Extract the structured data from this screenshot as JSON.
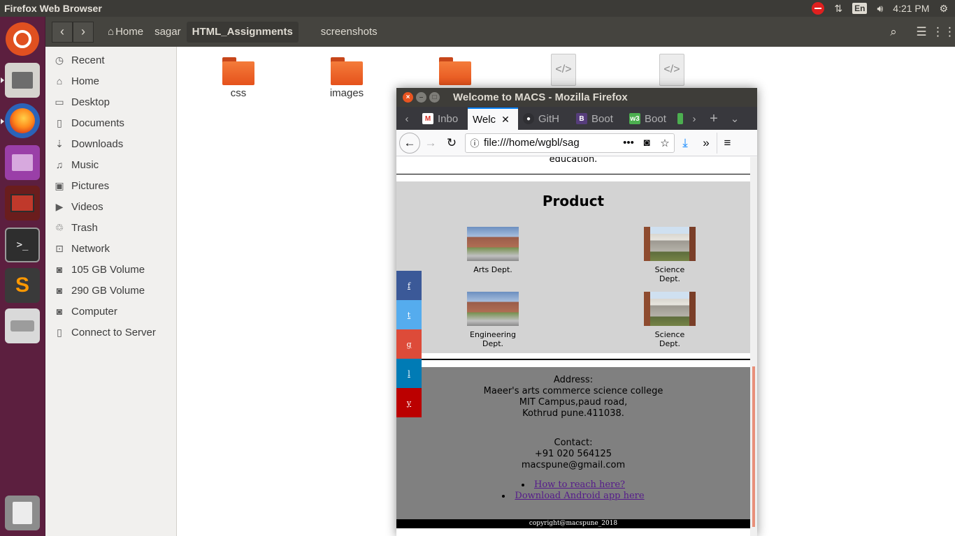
{
  "top_panel": {
    "app_title": "Firefox Web Browser",
    "lang": "En",
    "time": "4:21 PM"
  },
  "files": {
    "breadcrumbs": [
      "Home",
      "sagar",
      "HTML_Assignments",
      "screenshots"
    ],
    "sidebar": [
      {
        "label": "Recent",
        "icon": "clock-icon"
      },
      {
        "label": "Home",
        "icon": "home-icon"
      },
      {
        "label": "Desktop",
        "icon": "folder-icon"
      },
      {
        "label": "Documents",
        "icon": "document-icon"
      },
      {
        "label": "Downloads",
        "icon": "download-icon"
      },
      {
        "label": "Music",
        "icon": "music-icon"
      },
      {
        "label": "Pictures",
        "icon": "camera-icon"
      },
      {
        "label": "Videos",
        "icon": "video-icon"
      },
      {
        "label": "Trash",
        "icon": "trash-icon"
      },
      {
        "label": "Network",
        "icon": "network-icon"
      },
      {
        "label": "105 GB Volume",
        "icon": "disk-icon"
      },
      {
        "label": "290 GB Volume",
        "icon": "disk-icon"
      },
      {
        "label": "Computer",
        "icon": "computer-icon"
      },
      {
        "label": "Connect to Server",
        "icon": "server-icon"
      }
    ],
    "items": [
      {
        "label": "css",
        "type": "folder"
      },
      {
        "label": "images",
        "type": "folder"
      },
      {
        "label": "",
        "type": "folder"
      },
      {
        "label": "",
        "type": "html"
      },
      {
        "label": "",
        "type": "html"
      }
    ]
  },
  "firefox": {
    "window_title": "Welcome to MACS - Mozilla Firefox",
    "tabs": [
      {
        "label": "Inbo",
        "favicon": "gmail-icon"
      },
      {
        "label": "Welc",
        "favicon": "",
        "selected": true
      },
      {
        "label": "GitH",
        "favicon": "github-icon"
      },
      {
        "label": "Boot",
        "favicon": "bootstrap-icon"
      },
      {
        "label": "Boot",
        "favicon": "w3-icon"
      }
    ],
    "url": "file:///home/wgbl/sag",
    "page": {
      "top_text": "education.",
      "product_title": "Product",
      "products": [
        {
          "label": "Arts Dept.",
          "img": "campus"
        },
        {
          "label": "Science Dept.",
          "img": "dome"
        },
        {
          "label": "Engineering Dept.",
          "img": "campus"
        },
        {
          "label": "Science Dept.",
          "img": "dome"
        }
      ],
      "social": [
        {
          "letter": "f",
          "color": "#3b5998"
        },
        {
          "letter": "t",
          "color": "#55acee"
        },
        {
          "letter": "g",
          "color": "#dd4b39"
        },
        {
          "letter": "l",
          "color": "#007bb5"
        },
        {
          "letter": "y",
          "color": "#bb0000"
        }
      ],
      "address_heading": "Address:",
      "address_lines": [
        "Maeer's arts commerce science college",
        "MIT Campus,paud road,",
        "Kothrud pune.411038."
      ],
      "contact_heading": "Contact:",
      "contact_lines": [
        "+91 020 564125",
        "macspune@gmail.com"
      ],
      "links": [
        "How to reach here?",
        "Download Android app here"
      ],
      "copyright": "copyright@macspune_2018"
    }
  }
}
